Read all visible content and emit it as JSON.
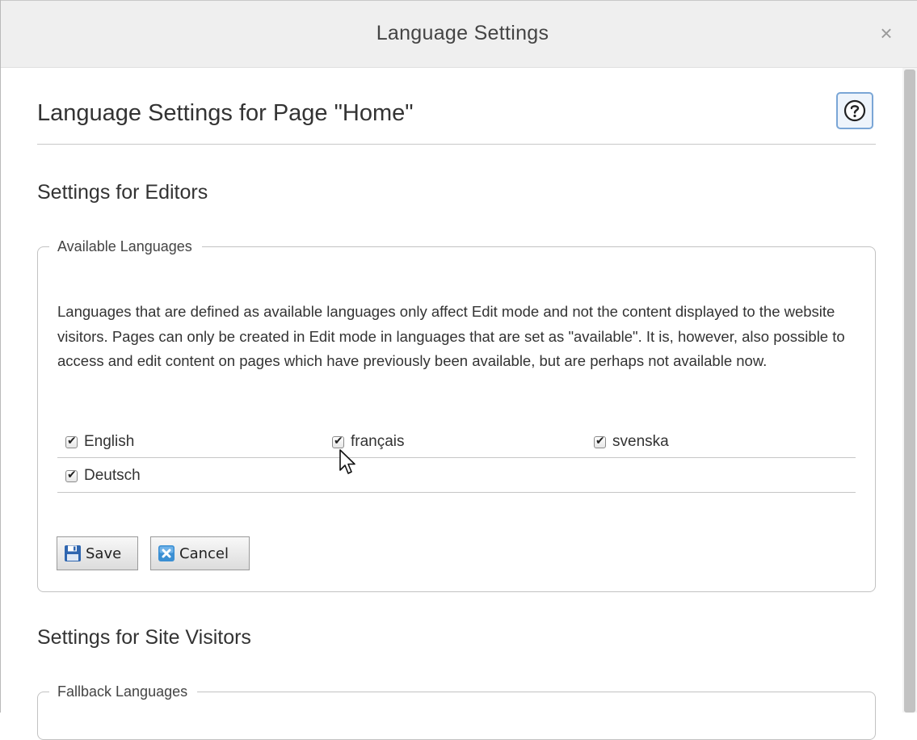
{
  "window": {
    "title": "Language Settings",
    "close_glyph": "×"
  },
  "page": {
    "title": "Language Settings for Page \"Home\"",
    "help_icon": "question-circle-icon"
  },
  "editors_section": {
    "heading": "Settings for Editors",
    "fieldset_legend": "Available Languages",
    "description": "Languages that are defined as available languages only affect Edit mode and not the content displayed to the website visitors. Pages can only be created in Edit mode in languages that are set as \"available\". It is, however, also possible to access and edit content on pages which have previously been available, but are perhaps not available now.",
    "languages": [
      {
        "label": "English",
        "checked": true
      },
      {
        "label": "français",
        "checked": true
      },
      {
        "label": "svenska",
        "checked": true
      },
      {
        "label": "Deutsch",
        "checked": true
      }
    ],
    "save_label": "Save",
    "cancel_label": "Cancel"
  },
  "visitors_section": {
    "heading": "Settings for Site Visitors",
    "fieldset_legend": "Fallback Languages"
  },
  "colors": {
    "titlebar_bg": "#efefef",
    "help_border": "#7aa6d6",
    "save_icon": "#2f66b0",
    "cancel_icon": "#3b8fd3"
  }
}
